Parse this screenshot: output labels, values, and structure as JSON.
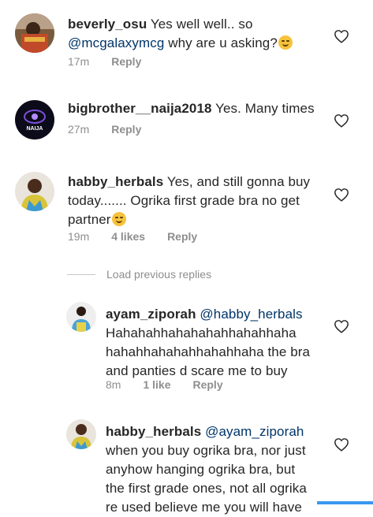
{
  "comments": [
    {
      "username": "beverly_osu",
      "text_before": " Yes well well.. so",
      "mention": "@mcgalaxymcg",
      "text_after": " why are u asking?",
      "time": "17m",
      "reply": "Reply"
    },
    {
      "username": "bigbrother__naija2018",
      "text": " Yes. Many times",
      "avatar_logo_text": "NAIJA",
      "time": "27m",
      "reply": "Reply"
    },
    {
      "username": "habby_herbals",
      "text": " Yes, and still gonna buy today....... Ogrika first grade bra no get partner",
      "time": "19m",
      "likes": "4 likes",
      "reply": "Reply"
    }
  ],
  "load_previous": "Load previous replies",
  "replies": [
    {
      "username": "ayam_ziporah",
      "mention": " @habby_herbals",
      "line1": "Hahahahhahahahahhahahhaha",
      "line2": "hahahhahahahhahahhaha the bra",
      "line3": "and panties d scare me to buy",
      "time": "8m",
      "likes": "1 like",
      "reply": "Reply"
    },
    {
      "username": "habby_herbals",
      "mention": " @ayam_ziporah",
      "line1": "when you buy ogrika bra, nor just",
      "line2": "anyhow hanging ogrika bra, but",
      "line3": "the first grade ones, not all ogrika",
      "line4": "re used  believe me you will have"
    }
  ]
}
